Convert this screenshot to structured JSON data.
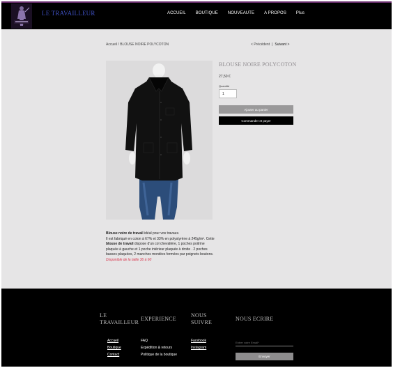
{
  "header": {
    "brand": "LE TRAVAILLEUR",
    "nav": [
      "ACCUEIL",
      "BOUTIQUE",
      "NOUVEAUTE",
      "A PROPOS",
      "Plus"
    ]
  },
  "breadcrumb": "Accueil / BLOUSE NOIRE POLYCOTON",
  "pager": {
    "prev": "< Précédent",
    "sep": "|",
    "next": "Suivant >"
  },
  "product": {
    "title": "BLOUSE NOIRE POLYCOTON",
    "price": "27,50 €",
    "quantity_label": "Quantité",
    "quantity_value": "1",
    "add_to_cart": "Ajouter au panier",
    "buy_now": "Commander et payer",
    "description": {
      "bold1": "Blouse noire de travail",
      "t1": " idéal pour vos travaux.",
      "t2": "Il est fabriqué en coton à 67% et 33% en polystyrène à 245g/m². Cette ",
      "bold2": "blouse de travail",
      "t3": " dispose d'un col chevalière, 1 poches poitrine plaquée à gauche et 1 poche intérieur plaquée à droite . 2 poches basses plaquées, 2 manches montées fermées par poignets boutons.",
      "availability": "Disponible de la taille 36 à 60"
    }
  },
  "footer": {
    "col1_title_line1": "LE",
    "col1_title_line2": "TRAVAILLEUR",
    "col2_title": "EXPERIENCE",
    "col3_title_line1": "NOUS",
    "col3_title_line2": "SUIVRE",
    "col4_title": "NOUS ECRIRE",
    "col1_links": [
      "Accueil",
      "Boutique",
      "Contact"
    ],
    "col2_links": [
      "FAQ",
      "Expédition & retours",
      "Politique de la boutique"
    ],
    "col3_links": [
      "Facebook",
      "Instagram"
    ],
    "email_placeholder": "Entrer votre Email*",
    "send": "Envoyer"
  },
  "colors": {
    "header_bg": "#000000",
    "brand": "#3d4fbf",
    "page_bg": "#e6e5e6",
    "availability": "#d8364d"
  }
}
